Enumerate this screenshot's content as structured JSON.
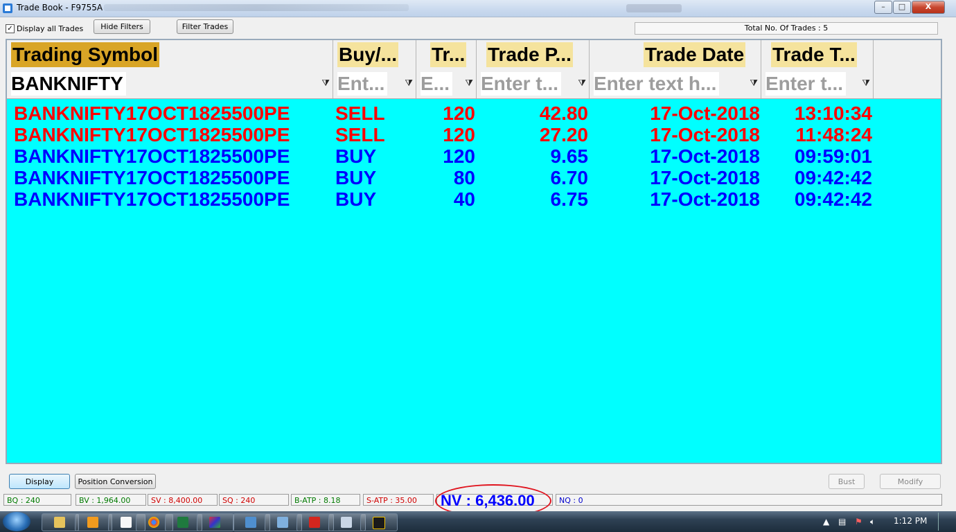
{
  "window": {
    "title": "Trade Book - F9755A",
    "min_label": "–",
    "max_label": "□",
    "close_label": "X"
  },
  "toolbar": {
    "display_all_label": "Display all Trades",
    "display_all_checked": true,
    "hide_filters_label": "Hide Filters",
    "filter_trades_label": "Filter Trades",
    "total_trades": "Total No. Of Trades : 5"
  },
  "grid": {
    "columns": [
      "Trading Symbol",
      "Buy/...",
      "Tr...",
      "Trade P...",
      "Trade Date",
      "Trade T..."
    ],
    "filters": [
      "BANKNIFTY",
      "Ent...",
      "E...",
      "Enter t...",
      "Enter text h...",
      "Enter t..."
    ],
    "rows": [
      {
        "symbol": "BANKNIFTY17OCT1825500PE",
        "side": "SELL",
        "qty": "120",
        "price": "42.80",
        "date": "17-Oct-2018",
        "time": "13:10:34",
        "color": "#ff0000"
      },
      {
        "symbol": "BANKNIFTY17OCT1825500PE",
        "side": "SELL",
        "qty": "120",
        "price": "27.20",
        "date": "17-Oct-2018",
        "time": "11:48:24",
        "color": "#ff0000"
      },
      {
        "symbol": "BANKNIFTY17OCT1825500PE",
        "side": "BUY",
        "qty": "120",
        "price": "9.65",
        "date": "17-Oct-2018",
        "time": "09:59:01",
        "color": "#0000ff"
      },
      {
        "symbol": "BANKNIFTY17OCT1825500PE",
        "side": "BUY",
        "qty": "80",
        "price": "6.70",
        "date": "17-Oct-2018",
        "time": "09:42:42",
        "color": "#0000ff"
      },
      {
        "symbol": "BANKNIFTY17OCT1825500PE",
        "side": "BUY",
        "qty": "40",
        "price": "6.75",
        "date": "17-Oct-2018",
        "time": "09:42:42",
        "color": "#0000ff"
      }
    ]
  },
  "bottom": {
    "display_label": "Display",
    "position_conversion_label": "Position Conversion",
    "bust_label": "Bust",
    "modify_label": "Modify"
  },
  "status": {
    "bq": "BQ : 240",
    "bv": "BV : 1,964.00",
    "sv": "SV : 8,400.00",
    "sq": "SQ : 240",
    "batp": "B-ATP : 8.18",
    "satp": "S-ATP : 35.00",
    "nv": "NV : 6,436.00",
    "nq": "NQ : 0"
  },
  "taskbar": {
    "clock": "1:12 PM",
    "icons": [
      "explorer-icon",
      "media-player-icon",
      "blank-doc-icon",
      "chrome-icon",
      "excel-icon",
      "app-triangle-icon",
      "folder-icon",
      "window-icon",
      "pdf-icon",
      "calculator-icon",
      "chart-app-icon"
    ]
  },
  "colors": {
    "grid_background": "#00ffff",
    "header_highlight": "#f5e39d",
    "sell": "#ff0000",
    "buy": "#0000ff",
    "annotation": "#e0141e"
  }
}
